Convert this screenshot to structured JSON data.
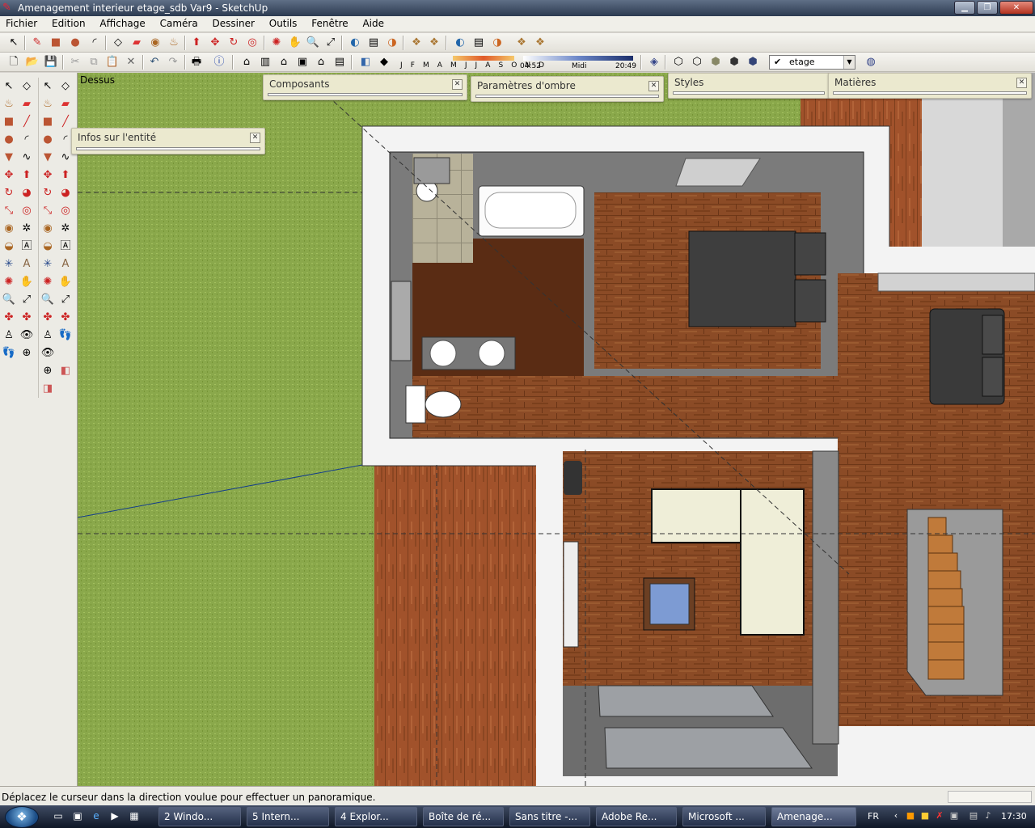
{
  "window": {
    "title": "Amenagement interieur etage_sdb Var9 - SketchUp"
  },
  "menu": [
    "Fichier",
    "Edition",
    "Affichage",
    "Caméra",
    "Dessiner",
    "Outils",
    "Fenêtre",
    "Aide"
  ],
  "shadow": {
    "months": "J F M A M J J A S O N D",
    "time_start": "04:52",
    "time_mid": "Midi",
    "time_end": "20:49"
  },
  "layer": {
    "value": "etage"
  },
  "viewport": {
    "label": "Dessus"
  },
  "panels": {
    "composants": "Composants",
    "ombre": "Paramètres d'ombre",
    "styles": "Styles",
    "matieres": "Matières",
    "infos": "Infos sur l'entité"
  },
  "status": {
    "text": "Déplacez le curseur dans la direction voulue pour effectuer un panoramique."
  },
  "taskbar": {
    "tasks": [
      {
        "label": "2 Windo..."
      },
      {
        "label": "5 Intern..."
      },
      {
        "label": "4 Explor..."
      },
      {
        "label": "Boîte de ré..."
      },
      {
        "label": "Sans titre -..."
      },
      {
        "label": "Adobe Re..."
      },
      {
        "label": "Microsoft ..."
      },
      {
        "label": "Amenage..."
      }
    ],
    "lang": "FR",
    "clock": "17:30"
  },
  "colors": {
    "grass": "#89a84a",
    "wood": "#8a4a24",
    "wall": "#f4f4f4",
    "walltop": "#777777",
    "panel": "#ebe9cf"
  }
}
